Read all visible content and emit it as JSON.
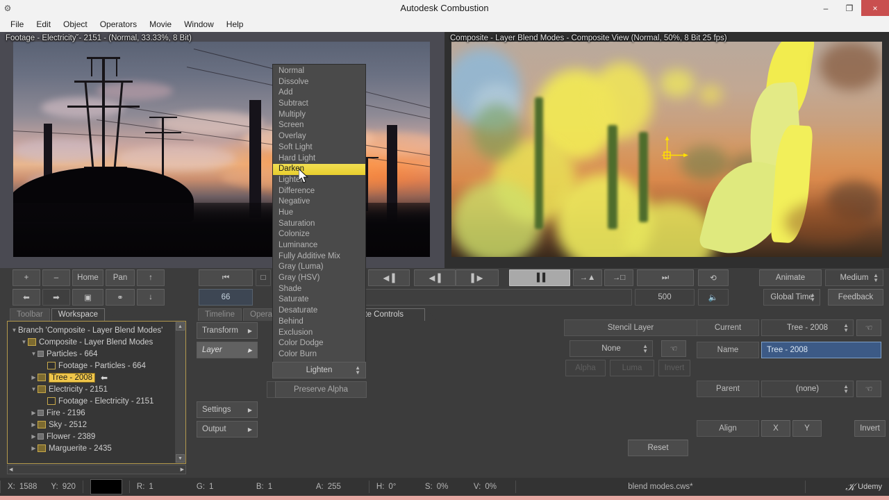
{
  "window": {
    "title": "Autodesk Combustion",
    "app_icon": "app-icon",
    "minimize": "–",
    "maximize": "❐",
    "close": "×"
  },
  "menubar": {
    "items": [
      "File",
      "Edit",
      "Object",
      "Operators",
      "Movie",
      "Window",
      "Help"
    ]
  },
  "viewports": {
    "left": {
      "label": "Footage - Electricity˘- 2151 -  (Normal, 33.33%, 8 Bit)"
    },
    "right": {
      "label": "Composite - Layer Blend Modes - Composite View (Normal, 50%, 8 Bit 25 fps)"
    }
  },
  "toolbar": {
    "zoom_in": "+",
    "zoom_out": "–",
    "home": "Home",
    "pan": "Pan",
    "load_up": "↑",
    "load_down": "↓",
    "prev": "⬅",
    "next": "➡",
    "split_view": "▣",
    "link": "⚭",
    "go_start": "⏮",
    "current_frame": "66",
    "step_back": "◀▐",
    "step_fwd": "▌▶",
    "play_pause": "▐▐",
    "to_in": "→▲",
    "to_out": "→□",
    "go_end": "⏭",
    "loop": "⟲",
    "total_frames": "500",
    "audio": "🔈",
    "key_square": "□",
    "animate": "Animate",
    "quality": "Medium",
    "time_mode": "Global Time",
    "feedback": "Feedback"
  },
  "panels": {
    "left_tabs": [
      {
        "label": "Toolbar",
        "selected": false
      },
      {
        "label": "Workspace",
        "selected": true
      }
    ],
    "center_tabs": [
      {
        "label": "Timeline",
        "selected": false
      },
      {
        "label": "Operators",
        "selected": false
      }
    ],
    "right_tab": {
      "label": "Composite Controls",
      "selected": true
    }
  },
  "workspace_tree": [
    {
      "indent": 0,
      "tri": "▼",
      "icon": "none",
      "label": "Branch 'Composite - Layer Blend Modes'",
      "selected": false
    },
    {
      "indent": 1,
      "tri": "▼",
      "icon": "layer",
      "label": "Composite - Layer Blend Modes",
      "selected": false
    },
    {
      "indent": 2,
      "tri": "▼",
      "icon": "plain",
      "label": "Particles - 664",
      "selected": false
    },
    {
      "indent": 3,
      "tri": "",
      "icon": "film",
      "label": "Footage - Particles - 664",
      "selected": false
    },
    {
      "indent": 2,
      "tri": "▶",
      "icon": "layer",
      "label": "Tree - 2008",
      "selected": true
    },
    {
      "indent": 2,
      "tri": "▼",
      "icon": "layer",
      "label": "Electricity - 2151",
      "selected": false
    },
    {
      "indent": 3,
      "tri": "",
      "icon": "film",
      "label": "Footage - Electricity - 2151",
      "selected": false
    },
    {
      "indent": 2,
      "tri": "▶",
      "icon": "plain",
      "label": "Fire - 2196",
      "selected": false
    },
    {
      "indent": 2,
      "tri": "▶",
      "icon": "layer",
      "label": "Sky - 2512",
      "selected": false
    },
    {
      "indent": 2,
      "tri": "▶",
      "icon": "plain",
      "label": "Flower - 2389",
      "selected": false
    },
    {
      "indent": 2,
      "tri": "▶",
      "icon": "layer",
      "label": "Marguerite - 2435",
      "selected": false
    }
  ],
  "operator_buttons": [
    {
      "label": "Transform",
      "arrow": "▶",
      "active": false
    },
    {
      "label": "Layer",
      "arrow": "▶",
      "active": true
    },
    {
      "label": "Settings",
      "arrow": "▶",
      "active": false
    },
    {
      "label": "Output",
      "arrow": "▶",
      "active": false
    }
  ],
  "blend_menu": {
    "items": [
      "Normal",
      "Dissolve",
      "Add",
      "Subtract",
      "Multiply",
      "Screen",
      "Overlay",
      "Soft Light",
      "Hard Light",
      "Darken",
      "Lighten",
      "Difference",
      "Negative",
      "Hue",
      "Saturation",
      "Colonize",
      "Luminance",
      "Fully Additive Mix",
      "Gray (Luma)",
      "Gray (HSV)",
      "Shade",
      "Saturate",
      "Desaturate",
      "Behind",
      "Exclusion",
      "Color Dodge",
      "Color Burn"
    ],
    "highlighted": "Darken",
    "current_value": "Lighten",
    "preserve_alpha_label": "Preserve Alpha",
    "highlight_color": "#edd43a"
  },
  "stencil": {
    "title": "Stencil Layer",
    "layer_value": "None",
    "alpha_label": "Alpha",
    "luma_label": "Luma",
    "invert_label": "Invert",
    "reset_label": "Reset",
    "picker_icon": "hand-pointer-icon"
  },
  "layer_controls": {
    "current_label": "Current",
    "current_value": "Tree - 2008",
    "name_label": "Name",
    "name_value": "Tree - 2008",
    "parent_label": "Parent",
    "parent_value": "(none)",
    "align_label": "Align",
    "align_x": "X",
    "align_y": "Y",
    "invert_label": "Invert"
  },
  "status": {
    "x_label": "X:",
    "x_value": "1588",
    "y_label": "Y:",
    "y_value": "920",
    "swatch_color": "#000000",
    "r_label": "R:",
    "r_value": "1",
    "g_label": "G:",
    "g_value": "1",
    "b_label": "B:",
    "b_value": "1",
    "a_label": "A:",
    "a_value": "255",
    "h_label": "H:",
    "h_value": "0°",
    "s_label": "S:",
    "s_value": "0%",
    "v_label": "V:",
    "v_value": "0%",
    "filename": "blend modes.cws*",
    "watermark": "Udemy"
  }
}
